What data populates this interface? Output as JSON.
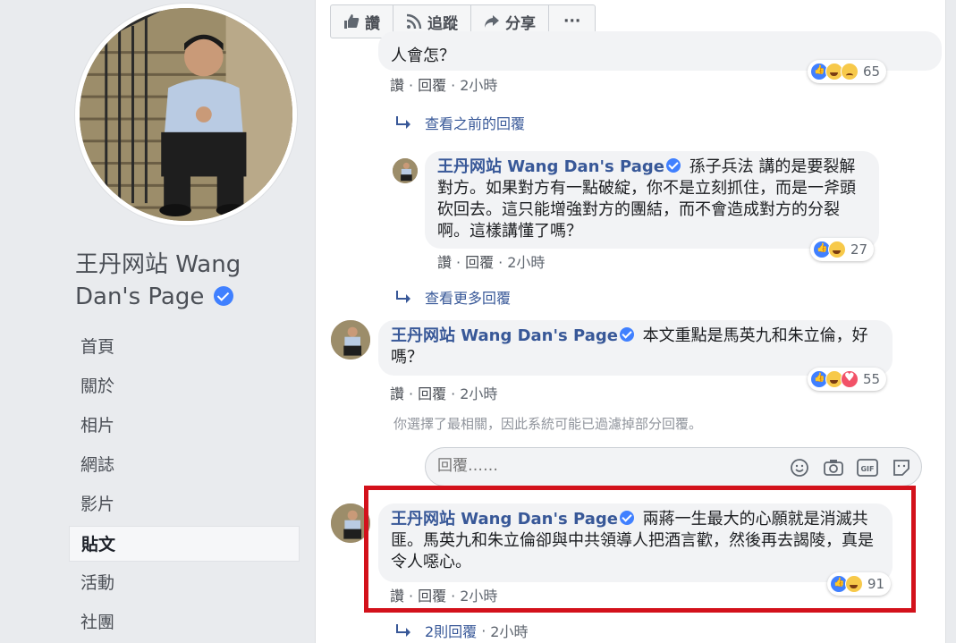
{
  "page": {
    "name": "王丹网站 Wang Dan's Page"
  },
  "nav": {
    "items": [
      "首頁",
      "關於",
      "相片",
      "網誌",
      "影片",
      "貼文",
      "活動",
      "社團"
    ],
    "active_index": 5
  },
  "actions": {
    "like": "讚",
    "follow": "追蹤",
    "share": "分享",
    "more": "···"
  },
  "colors": {
    "link": "#385898",
    "highlight": "#d3111b",
    "like": "#4080ff"
  },
  "comments": {
    "top_partial": {
      "text_fragment": "人會怎？",
      "like_label": "讚",
      "reply_label": "回覆",
      "time": "2小時",
      "reactions_count": "65"
    },
    "view_previous": "查看之前的回覆",
    "reply1": {
      "author": "王丹网站 Wang Dan's Page",
      "text": "孫子兵法 講的是要裂解對方。如果對方有一點破綻，你不是立刻抓住，而是一斧頭砍回去。這只能增強對方的團結，而不會造成對方的分裂啊。這樣講懂了嗎？",
      "like_label": "讚",
      "reply_label": "回覆",
      "time": "2小時",
      "reactions_count": "27"
    },
    "view_more": "查看更多回覆",
    "comment2": {
      "author": "王丹网站 Wang Dan's Page",
      "text": "本文重點是馬英九和朱立倫，好嗎？",
      "like_label": "讚",
      "reply_label": "回覆",
      "time": "2小時",
      "reactions_count": "55"
    },
    "filter_note": "你選擇了最相關，因此系統可能已過濾掉部分回覆。",
    "reply_placeholder": "回覆……",
    "comment3": {
      "author": "王丹网站 Wang Dan's Page",
      "text": "兩蔣一生最大的心願就是消滅共匪。馬英九和朱立倫卻與中共領導人把酒言歡，然後再去謁陵，真是令人噁心。",
      "like_label": "讚",
      "reply_label": "回覆",
      "time": "2小時",
      "reactions_count": "91"
    },
    "replies_summary": {
      "label": "2則回覆",
      "time": "2小時"
    }
  }
}
